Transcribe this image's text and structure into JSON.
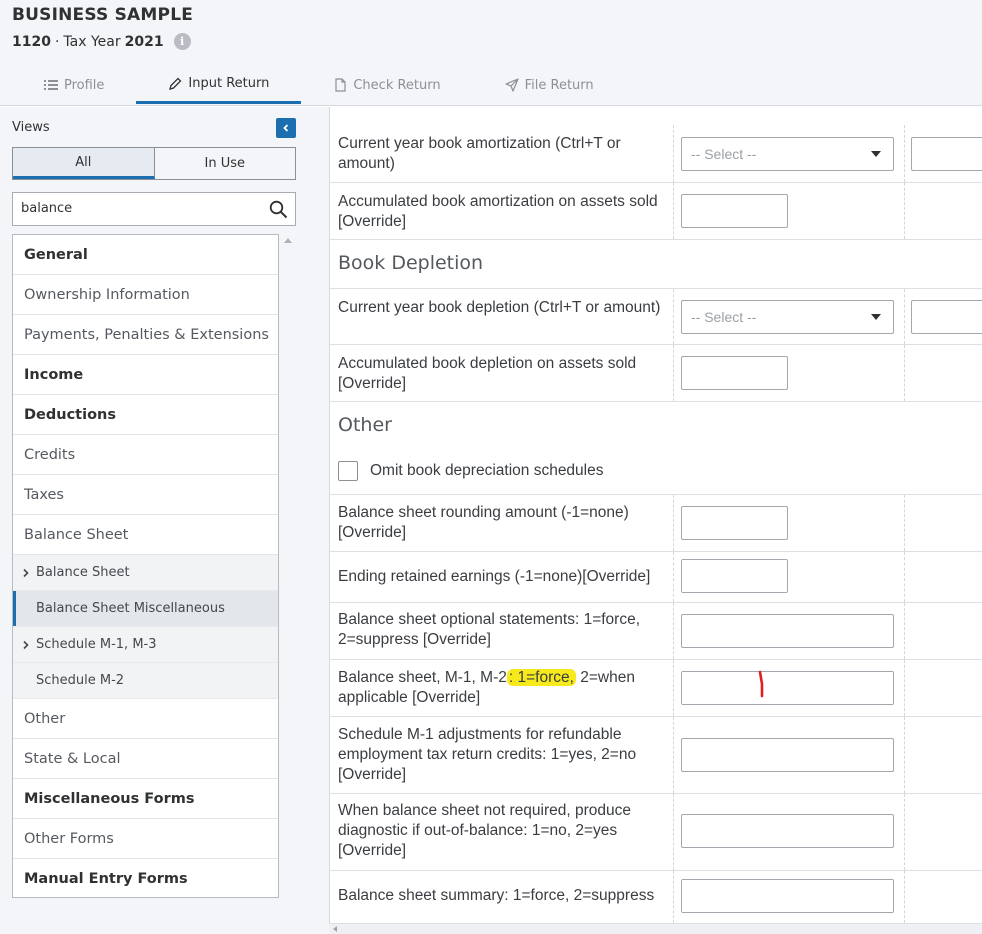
{
  "header": {
    "client_name": "BUSINESS SAMPLE",
    "form": "1120",
    "separator": "·",
    "tax_year_label": "Tax Year",
    "tax_year": "2021",
    "info_icon": "info-icon"
  },
  "tabs": [
    {
      "label": "Profile",
      "icon": "list-icon",
      "active": false
    },
    {
      "label": "Input Return",
      "icon": "pencil-icon",
      "active": true
    },
    {
      "label": "Check Return",
      "icon": "document-icon",
      "active": false
    },
    {
      "label": "File Return",
      "icon": "paper-plane-icon",
      "active": false
    }
  ],
  "sidebar": {
    "views_label": "Views",
    "toggle": {
      "all": "All",
      "in_use": "In Use",
      "selected": "All"
    },
    "search_value": "balance",
    "items": [
      {
        "label": "General",
        "bold": true
      },
      {
        "label": "Ownership Information",
        "bold": false
      },
      {
        "label": "Payments, Penalties & Extensions",
        "bold": false
      },
      {
        "label": "Income",
        "bold": true
      },
      {
        "label": "Deductions",
        "bold": true
      },
      {
        "label": "Credits",
        "bold": false
      },
      {
        "label": "Taxes",
        "bold": false
      },
      {
        "label": "Balance Sheet",
        "bold": false
      }
    ],
    "sub_items": [
      {
        "label": "Balance Sheet",
        "expandable": true
      },
      {
        "label": "Balance Sheet Miscellaneous",
        "expandable": false,
        "selected": true
      },
      {
        "label": "Schedule M-1, M-3",
        "expandable": true
      },
      {
        "label": "Schedule M-2",
        "expandable": false
      }
    ],
    "items_after": [
      {
        "label": "Other",
        "bold": false
      },
      {
        "label": "State & Local",
        "bold": false
      },
      {
        "label": "Miscellaneous Forms",
        "bold": true
      },
      {
        "label": "Other Forms",
        "bold": false
      },
      {
        "label": "Manual Entry Forms",
        "bold": true
      }
    ]
  },
  "main": {
    "select_placeholder": "-- Select --",
    "rows": {
      "r1": "Current year book amortization (Ctrl+T or amount)",
      "r2": "Accumulated book amortization on assets sold [Override]",
      "section_depletion": "Book Depletion",
      "r3": "Current year book depletion (Ctrl+T or amount)",
      "r4": "Accumulated book depletion on assets sold [Override]",
      "section_other": "Other",
      "checkbox_omit": "Omit book depreciation schedules",
      "r5": "Balance sheet rounding amount (-1=none) [Override]",
      "r6": "Ending retained earnings (-1=none)[Override]",
      "r7": "Balance sheet optional statements: 1=force, 2=suppress [Override]",
      "r8_pre": "Balance sheet, M-1, M-2",
      "r8_hl": ": 1=force,",
      "r8_post": " 2=when applicable [Override]",
      "r9": "Schedule M-1 adjustments for refundable employment tax return credits: 1=yes, 2=no [Override]",
      "r10": "When balance sheet not required, produce diagnostic if out-of-balance: 1=no, 2=yes [Override]",
      "r11": "Balance sheet summary: 1=force, 2=suppress"
    },
    "highlight_color": "#f6ea1c",
    "annotation_color": "#e02020"
  },
  "colors": {
    "accent": "#1b6eb0",
    "bg": "#f4f5f8"
  }
}
